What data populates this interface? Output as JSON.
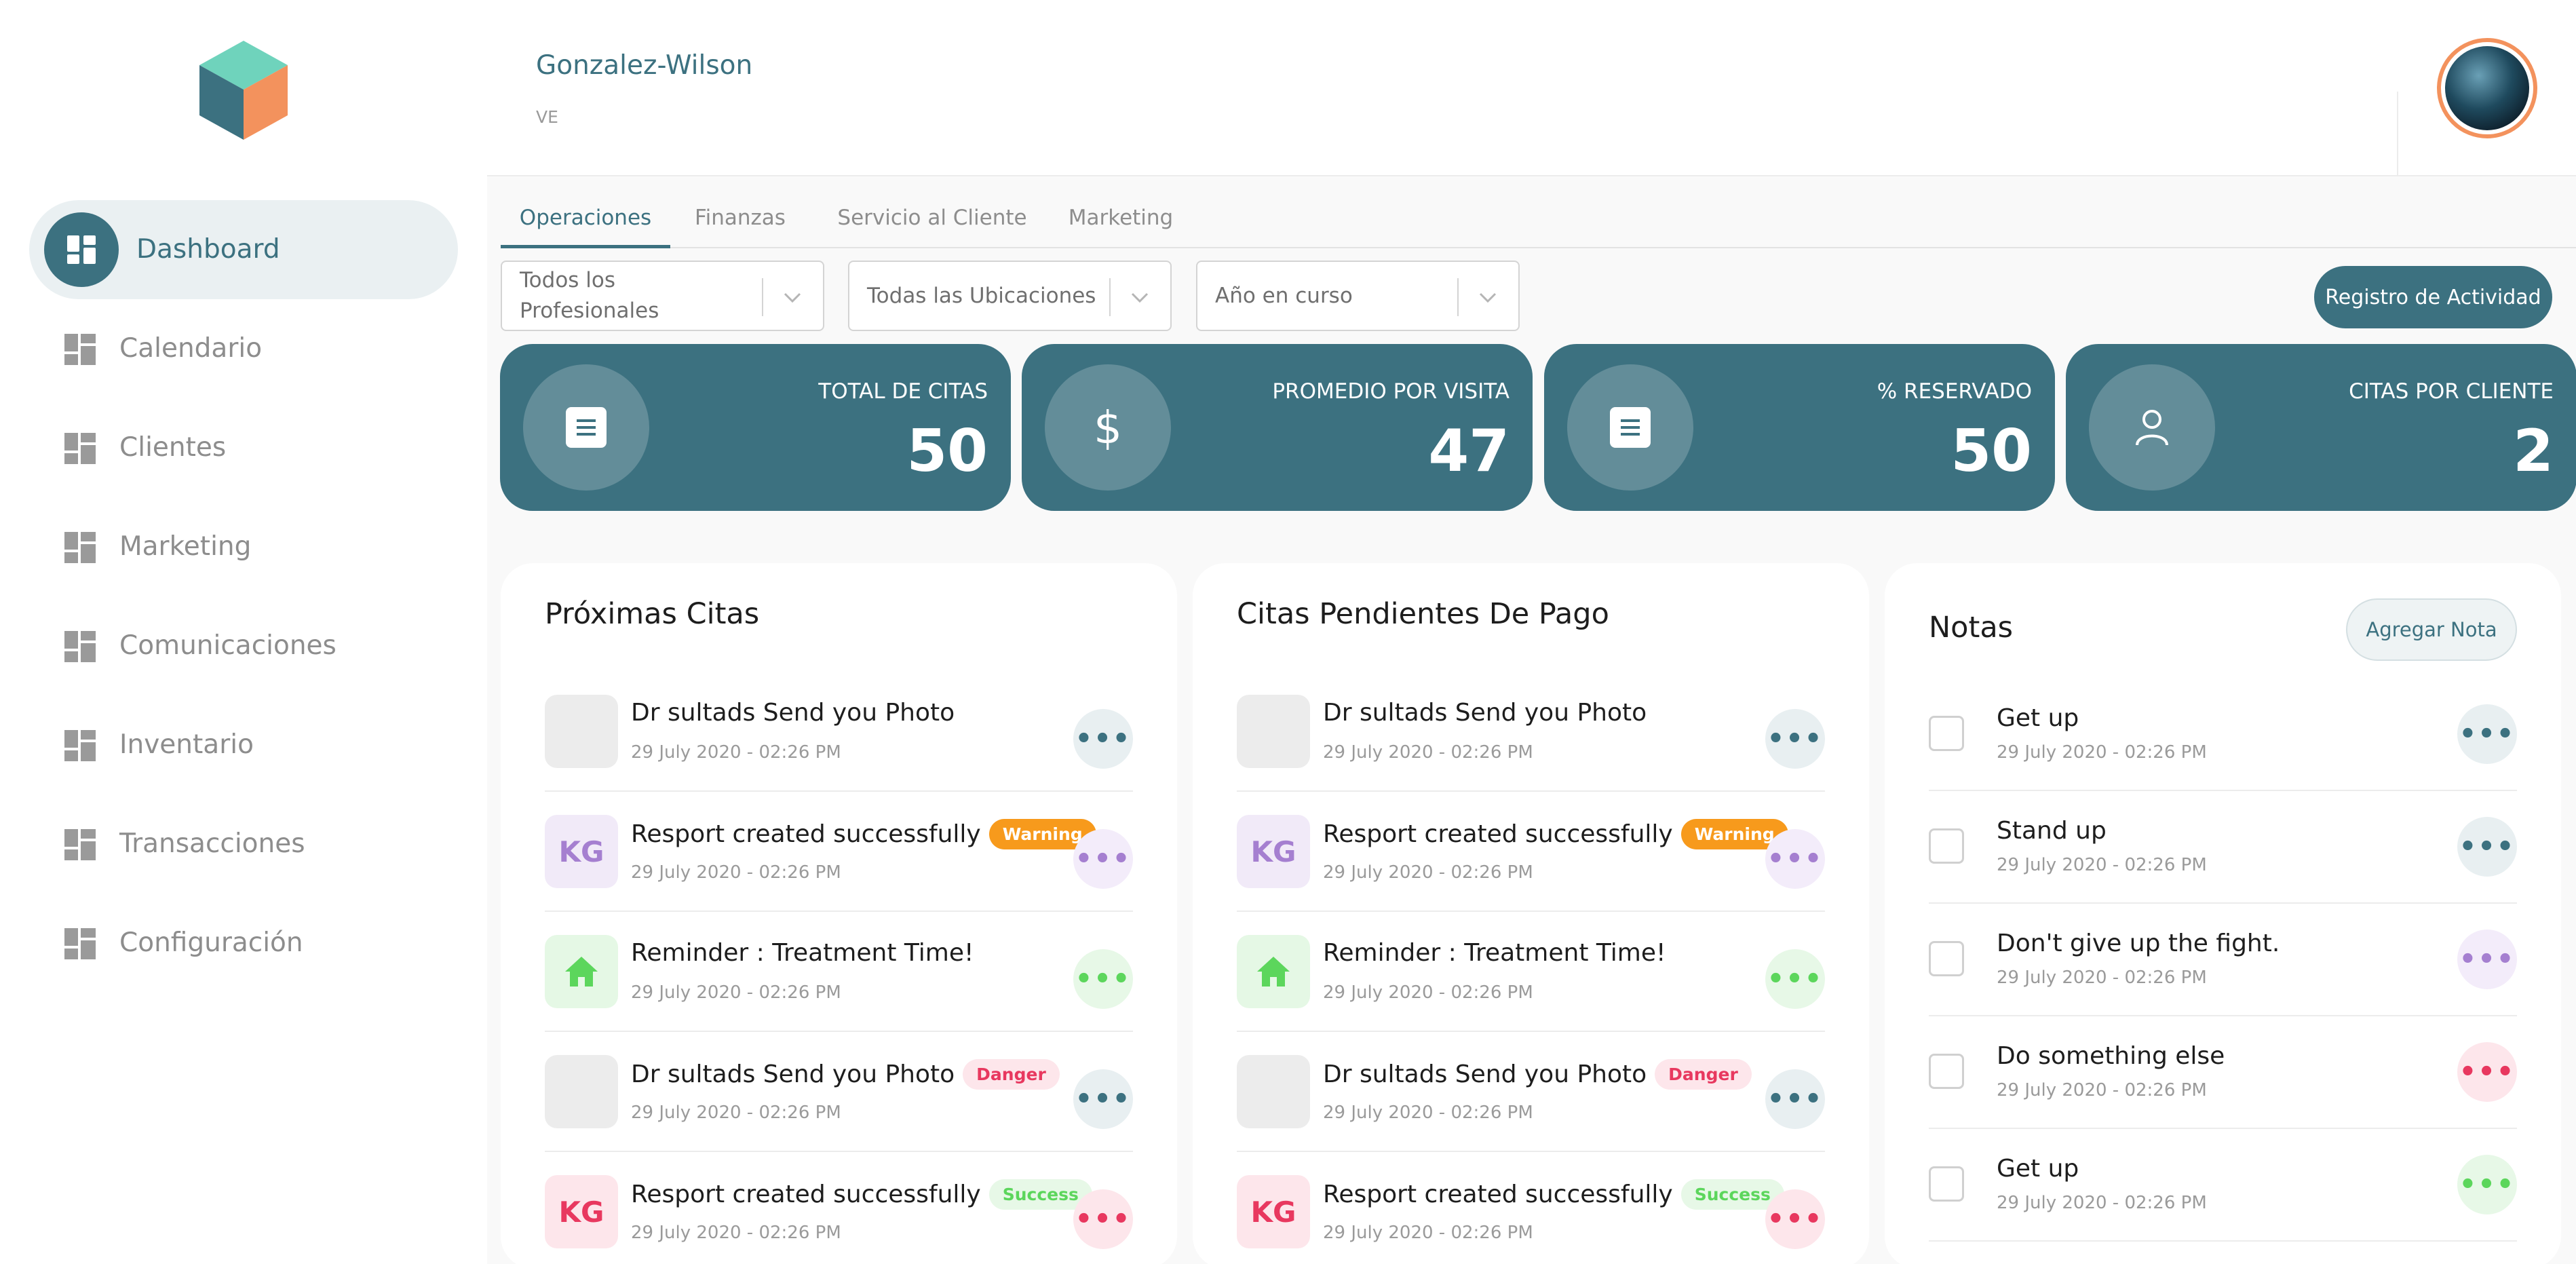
{
  "sidebar": {
    "items": [
      {
        "label": "Dashboard"
      },
      {
        "label": "Calendario"
      },
      {
        "label": "Clientes"
      },
      {
        "label": "Marketing"
      },
      {
        "label": "Comunicaciones"
      },
      {
        "label": "Inventario"
      },
      {
        "label": "Transacciones"
      },
      {
        "label": "Configuración"
      }
    ]
  },
  "header": {
    "org_name": "Gonzalez-Wilson",
    "org_code": "VE"
  },
  "tabs": [
    {
      "label": "Operaciones"
    },
    {
      "label": "Finanzas"
    },
    {
      "label": "Servicio al Cliente"
    },
    {
      "label": "Marketing"
    }
  ],
  "filters": {
    "professionals": "Todos los Profesionales",
    "locations": "Todas las Ubicaciones",
    "period": "Año en curso"
  },
  "activity_button": "Registro de Actividad",
  "stats": [
    {
      "label": "TOTAL DE CITAS",
      "value": "50",
      "icon": "document-icon"
    },
    {
      "label": "PROMEDIO POR VISITA",
      "value": "47",
      "icon": "dollar-icon"
    },
    {
      "label": "% RESERVADO",
      "value": "50",
      "icon": "document-icon"
    },
    {
      "label": "CITAS POR CLIENTE",
      "value": "2",
      "icon": "user-icon"
    }
  ],
  "upcoming": {
    "title": "Próximas Citas",
    "rows": [
      {
        "title": "Dr sultads Send you Photo",
        "date": "29 July 2020 - 02:26 PM",
        "badge": "",
        "initials": ""
      },
      {
        "title": "Resport created successfully",
        "date": "29 July 2020 - 02:26 PM",
        "badge": "Warning",
        "initials": "KG"
      },
      {
        "title": "Reminder : Treatment Time!",
        "date": "29 July 2020 - 02:26 PM",
        "badge": "",
        "initials": ""
      },
      {
        "title": "Dr sultads Send you Photo",
        "date": "29 July 2020 - 02:26 PM",
        "badge": "Danger",
        "initials": ""
      },
      {
        "title": "Resport created successfully",
        "date": "29 July 2020 - 02:26 PM",
        "badge": "Success",
        "initials": "KG"
      }
    ]
  },
  "pending": {
    "title": "Citas Pendientes De Pago",
    "rows": [
      {
        "title": "Dr sultads Send you Photo",
        "date": "29 July 2020 - 02:26 PM",
        "badge": "",
        "initials": ""
      },
      {
        "title": "Resport created successfully",
        "date": "29 July 2020 - 02:26 PM",
        "badge": "Warning",
        "initials": "KG"
      },
      {
        "title": "Reminder : Treatment Time!",
        "date": "29 July 2020 - 02:26 PM",
        "badge": "",
        "initials": ""
      },
      {
        "title": "Dr sultads Send you Photo",
        "date": "29 July 2020 - 02:26 PM",
        "badge": "Danger",
        "initials": ""
      },
      {
        "title": "Resport created successfully",
        "date": "29 July 2020 - 02:26 PM",
        "badge": "Success",
        "initials": "KG"
      }
    ]
  },
  "notes": {
    "title": "Notas",
    "add_label": "Agregar Nota",
    "items": [
      {
        "title": "Get up",
        "date": "29 July 2020 - 02:26 PM"
      },
      {
        "title": "Stand up",
        "date": "29 July 2020 - 02:26 PM"
      },
      {
        "title": "Don't give up the fight.",
        "date": "29 July 2020 - 02:26 PM"
      },
      {
        "title": "Do something else",
        "date": "29 July 2020 - 02:26 PM"
      },
      {
        "title": "Get up",
        "date": "29 July 2020 - 02:26 PM"
      }
    ]
  },
  "colors": {
    "primary": "#3c7180",
    "warning": "#f79a1c",
    "danger": "#e8385f",
    "success": "#5cd65c",
    "purple": "#a57fd0",
    "logo_top": "#6fd3bc",
    "logo_left": "#3c7180",
    "logo_right": "#f3925d"
  }
}
